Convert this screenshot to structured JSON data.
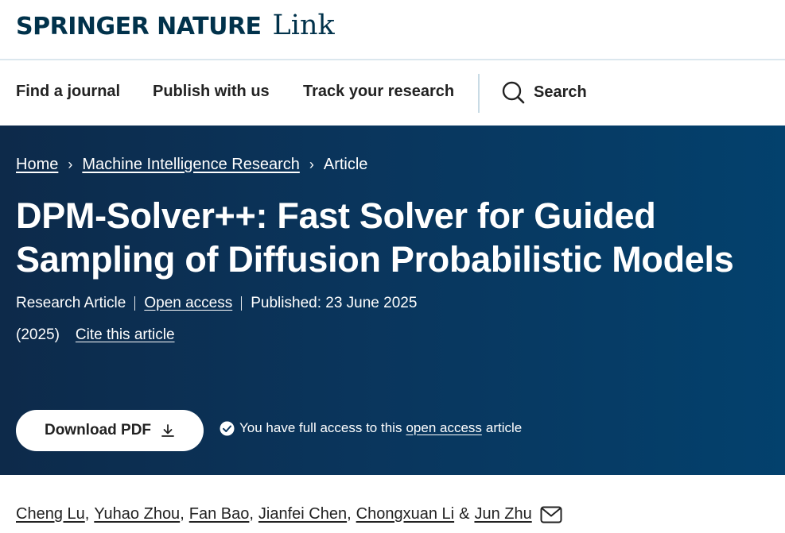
{
  "header": {
    "brand_main": "SPRINGER NATURE",
    "brand_sub": "Link"
  },
  "nav": {
    "items": [
      {
        "label": "Find a journal"
      },
      {
        "label": "Publish with us"
      },
      {
        "label": "Track your research"
      }
    ],
    "search_label": "Search",
    "search_icon": "search-icon"
  },
  "breadcrumb": {
    "home": "Home",
    "journal": "Machine Intelligence Research",
    "current": "Article",
    "separator": "›"
  },
  "article": {
    "title": "DPM-Solver++: Fast Solver for Guided Sampling of Diffusion Probabilistic Models",
    "type": "Research Article",
    "access": "Open access",
    "published": "Published: 23 June 2025",
    "year": "(2025)",
    "cite": "Cite this article"
  },
  "actions": {
    "download_label": "Download PDF",
    "download_icon": "download-icon",
    "access_prefix": "You have full access to this",
    "access_link": "open access",
    "access_suffix": "article",
    "access_icon": "check-circle-icon"
  },
  "authors": {
    "names": [
      "Cheng Lu",
      "Yuhao Zhou",
      "Fan Bao",
      "Jianfei Chen",
      "Chongxuan Li",
      "Jun Zhu"
    ],
    "separator": ",",
    "amp": "&",
    "email_icon": "mail-icon"
  },
  "colors": {
    "brand": "#01324b",
    "hero_start": "#0d2a4a",
    "hero_end": "#03416d",
    "divider": "#dbe7ee"
  }
}
